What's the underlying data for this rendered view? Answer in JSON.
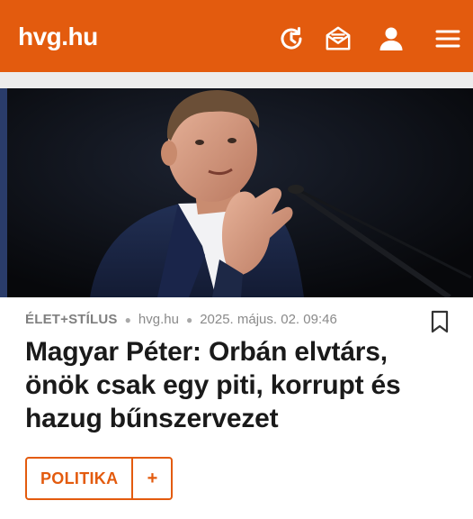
{
  "header": {
    "logo": "hvg.hu",
    "icons": [
      "history-icon",
      "newsletter-icon",
      "user-icon",
      "menu-icon"
    ],
    "bg_color": "#e35b0e"
  },
  "article": {
    "image_alt": "Magyar Péter speaking at a podium",
    "category": "ÉLET+STÍLUS",
    "source": "hvg.hu",
    "datetime": "2025. május. 02. 09:46",
    "headline": "Magyar Péter: Orbán elvtárs, önök csak egy piti, korrupt és hazug bűnszervezet",
    "tag": "POLITIKA",
    "tag_add": "+"
  }
}
